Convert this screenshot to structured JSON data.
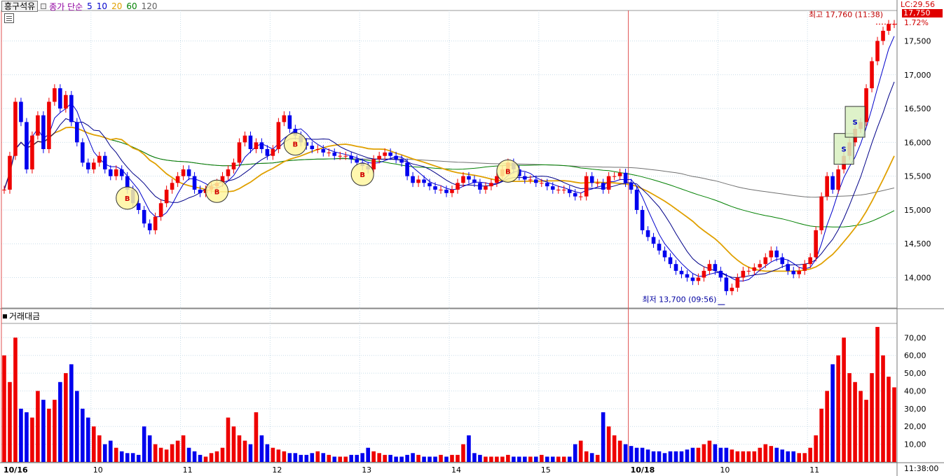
{
  "header": {
    "stock_name": "흥구석유",
    "series_label": "종가 단순",
    "ma_labels": [
      {
        "label": "5",
        "color": "#0000cc"
      },
      {
        "label": "10",
        "color": "#0000cc"
      },
      {
        "label": "20",
        "color": "#e0a000"
      },
      {
        "label": "60",
        "color": "#008000"
      },
      {
        "label": "120",
        "color": "#606060"
      }
    ]
  },
  "right_panel": {
    "lc_label": "LC:29.56",
    "current_price": "17,750",
    "change_pct": "1.72%",
    "time_label": "11:38:00"
  },
  "volume_panel": {
    "title": "거래대금"
  },
  "colors": {
    "up": "#ee0000",
    "down": "#0000ee",
    "ma5": "#0000cc",
    "ma10": "#000088",
    "ma20": "#e0a000",
    "ma60": "#008000",
    "ma120": "#707070",
    "grid": "#c8dce8"
  },
  "chart_data": {
    "type": "candlestick",
    "price_axis": {
      "ticks": [
        14000,
        14500,
        15000,
        15500,
        16000,
        16500,
        17000,
        17500
      ],
      "tick_labels": [
        "14,000",
        "14,500",
        "15,000",
        "15,500",
        "16,000",
        "16,500",
        "17,000",
        "17,500"
      ],
      "range": [
        13550,
        17950
      ]
    },
    "volume_axis": {
      "ticks": [
        10,
        20,
        30,
        40,
        50,
        60,
        70
      ],
      "tick_labels": [
        "10,00",
        "20,00",
        "30,00",
        "40,00",
        "50,00",
        "60,00",
        "70,00"
      ],
      "range": [
        0,
        78
      ]
    },
    "x_axis_labels": [
      "10/16",
      "10",
      "11",
      "12",
      "13",
      "14",
      "15",
      "10/18",
      "10",
      "11"
    ],
    "annotations": {
      "high_label": "최고 17,760 (11:38)",
      "low_label": "최저 13,700 (09:56)"
    },
    "signals": [
      "B",
      "B",
      "B",
      "B",
      "B",
      "S",
      "S"
    ],
    "close_series": [
      15300,
      15800,
      16600,
      16300,
      15600,
      16100,
      16400,
      15900,
      16600,
      16800,
      16500,
      16700,
      16300,
      16000,
      15700,
      15600,
      15700,
      15800,
      15600,
      15500,
      15600,
      15500,
      15300,
      15100,
      15000,
      14800,
      14700,
      14900,
      15100,
      15300,
      15400,
      15500,
      15600,
      15500,
      15300,
      15250,
      15300,
      15350,
      15400,
      15500,
      15600,
      15700,
      16000,
      16100,
      15900,
      16000,
      15900,
      15800,
      15900,
      16300,
      16400,
      16200,
      16100,
      16000,
      15950,
      15900,
      15900,
      15850,
      15850,
      15800,
      15800,
      15800,
      15750,
      15700,
      15650,
      15600,
      15750,
      15800,
      15850,
      15800,
      15750,
      15700,
      15500,
      15400,
      15450,
      15400,
      15350,
      15300,
      15300,
      15250,
      15300,
      15400,
      15500,
      15450,
      15400,
      15300,
      15350,
      15400,
      15500,
      15600,
      15700,
      15600,
      15500,
      15450,
      15450,
      15400,
      15400,
      15350,
      15300,
      15300,
      15300,
      15250,
      15200,
      15200,
      15500,
      15400,
      15400,
      15300,
      15500,
      15500,
      15550,
      15400,
      15300,
      15000,
      14700,
      14600,
      14500,
      14400,
      14300,
      14200,
      14100,
      14050,
      14000,
      13950,
      14000,
      14100,
      14200,
      14100,
      14000,
      13800,
      13850,
      14000,
      14100,
      14100,
      14150,
      14200,
      14300,
      14400,
      14300,
      14200,
      14100,
      14050,
      14100,
      14200,
      14300,
      14700,
      15200,
      15500,
      15300,
      15600,
      15800,
      16000,
      16200,
      16300,
      16800,
      17200,
      17500,
      17650,
      17750,
      17750
    ],
    "volume_series": [
      60,
      45,
      70,
      30,
      28,
      25,
      40,
      35,
      30,
      35,
      45,
      50,
      55,
      40,
      30,
      25,
      20,
      15,
      10,
      12,
      8,
      6,
      5,
      5,
      4,
      20,
      15,
      10,
      8,
      7,
      10,
      12,
      15,
      8,
      6,
      4,
      3,
      5,
      6,
      8,
      25,
      20,
      15,
      12,
      10,
      28,
      15,
      10,
      8,
      7,
      6,
      5,
      5,
      4,
      4,
      5,
      6,
      5,
      4,
      3,
      3,
      3,
      4,
      4,
      5,
      8,
      6,
      5,
      4,
      4,
      3,
      3,
      4,
      5,
      4,
      3,
      3,
      3,
      4,
      3,
      4,
      4,
      10,
      15,
      5,
      4,
      3,
      3,
      3,
      3,
      4,
      3,
      3,
      3,
      3,
      3,
      4,
      3,
      3,
      3,
      3,
      3,
      10,
      12,
      6,
      5,
      4,
      28,
      20,
      15,
      12,
      10,
      9,
      8,
      8,
      7,
      6,
      6,
      5,
      6,
      6,
      6,
      7,
      8,
      8,
      10,
      12,
      10,
      8,
      8,
      7,
      6,
      6,
      6,
      6,
      8,
      10,
      9,
      8,
      7,
      6,
      6,
      5,
      5,
      8,
      15,
      30,
      40,
      55,
      60,
      70,
      50,
      45,
      40,
      35,
      50,
      76,
      60,
      48,
      42
    ]
  }
}
